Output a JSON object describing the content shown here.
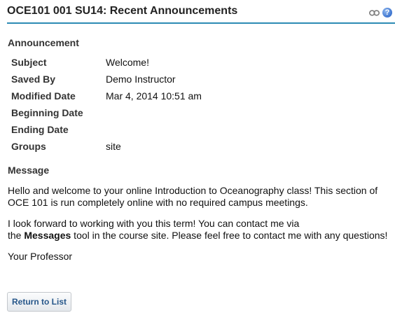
{
  "header": {
    "title": "OCE101 001 SU14: Recent Announcements",
    "icons": [
      "link-icon",
      "help-icon"
    ],
    "help_glyph": "?",
    "accent_color": "#2d8bb4"
  },
  "announcement": {
    "heading": "Announcement",
    "fields": [
      {
        "label": "Subject",
        "value": "Welcome!"
      },
      {
        "label": "Saved By",
        "value": "Demo Instructor"
      },
      {
        "label": "Modified Date",
        "value": "Mar 4, 2014 10:51 am"
      },
      {
        "label": "Beginning Date",
        "value": ""
      },
      {
        "label": "Ending Date",
        "value": ""
      },
      {
        "label": "Groups",
        "value": "site"
      }
    ]
  },
  "message": {
    "heading": "Message",
    "para1": "Hello and welcome to your online Introduction to Oceanography class!  This section of OCE 101 is run completely online with no required campus meetings.",
    "para2_line1": "I look forward to working with you this term!   You can contact me via",
    "para2_pre": "the ",
    "para2_bold": "Messages",
    "para2_post": " tool in the course site. Please feel free to contact me with any questions!",
    "signature": "Your Professor"
  },
  "actions": {
    "return_label": "Return to List"
  }
}
